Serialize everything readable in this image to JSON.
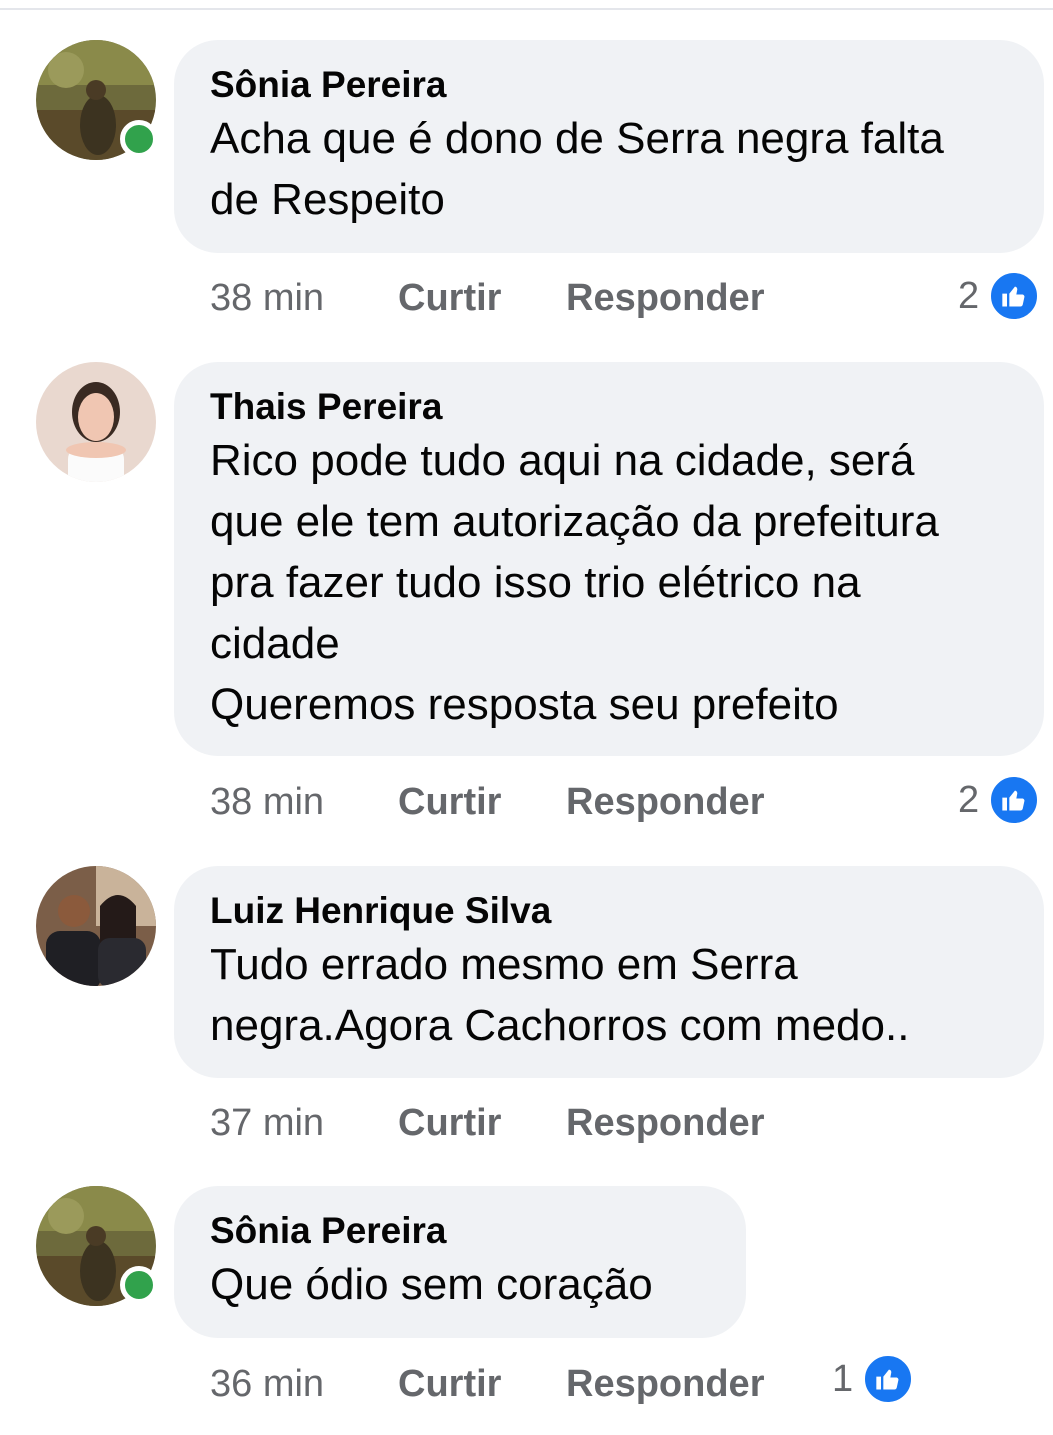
{
  "comments": [
    {
      "author": "Sônia Pereira",
      "text": "Acha que é dono de Serra negra falta\nde Respeito",
      "time": "38 min",
      "like_label": "Curtir",
      "reply_label": "Responder",
      "reaction_count": "2",
      "online": true
    },
    {
      "author": "Thais Pereira",
      "text": "Rico pode tudo aqui na cidade, será\nque ele tem autorização da prefeitura\npra fazer tudo isso trio elétrico na\ncidade\nQueremos resposta seu prefeito",
      "time": "38 min",
      "like_label": "Curtir",
      "reply_label": "Responder",
      "reaction_count": "2",
      "online": false
    },
    {
      "author": "Luiz Henrique Silva",
      "text": "Tudo errado mesmo em Serra\nnegra.Agora  Cachorros com medo..",
      "time": "37 min",
      "like_label": "Curtir",
      "reply_label": "Responder",
      "online": false
    },
    {
      "author": "Sônia Pereira",
      "text": "Que ódio  sem coração",
      "time": "36 min",
      "like_label": "Curtir",
      "reply_label": "Responder",
      "reaction_count": "1",
      "online": true
    }
  ],
  "colors": {
    "bubble": "#f0f2f5",
    "online": "#31a24c",
    "like_blue": "#1877f2",
    "meta_text": "#65676b"
  },
  "icons": {
    "online": "online-status-icon",
    "reaction": "thumbs-up-icon"
  }
}
